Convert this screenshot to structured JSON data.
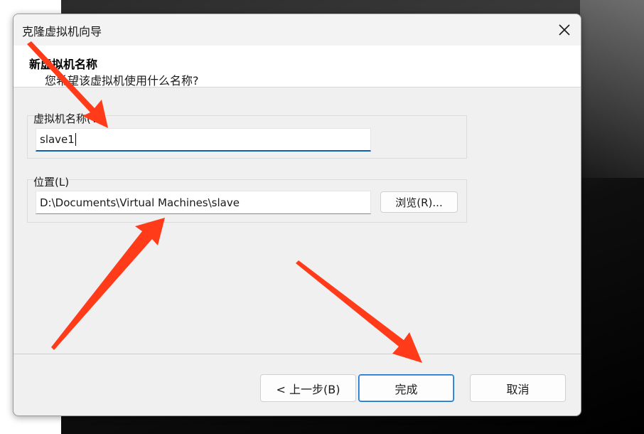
{
  "window": {
    "title": "克隆虚拟机向导"
  },
  "header": {
    "title": "新虚拟机名称",
    "subtitle": "您希望该虚拟机使用什么名称?"
  },
  "name_field": {
    "label": "虚拟机名称(V)",
    "value": "slave1"
  },
  "location_field": {
    "label": "位置(L)",
    "value": "D:\\Documents\\Virtual Machines\\slave",
    "browse_label": "浏览(R)..."
  },
  "buttons": {
    "back": "< 上一步(B)",
    "finish": "完成",
    "cancel": "取消"
  },
  "colors": {
    "annotation_arrow": "#ff3b1a",
    "focus_accent": "#0f5fb0"
  },
  "icons": {
    "close": "close-icon"
  }
}
